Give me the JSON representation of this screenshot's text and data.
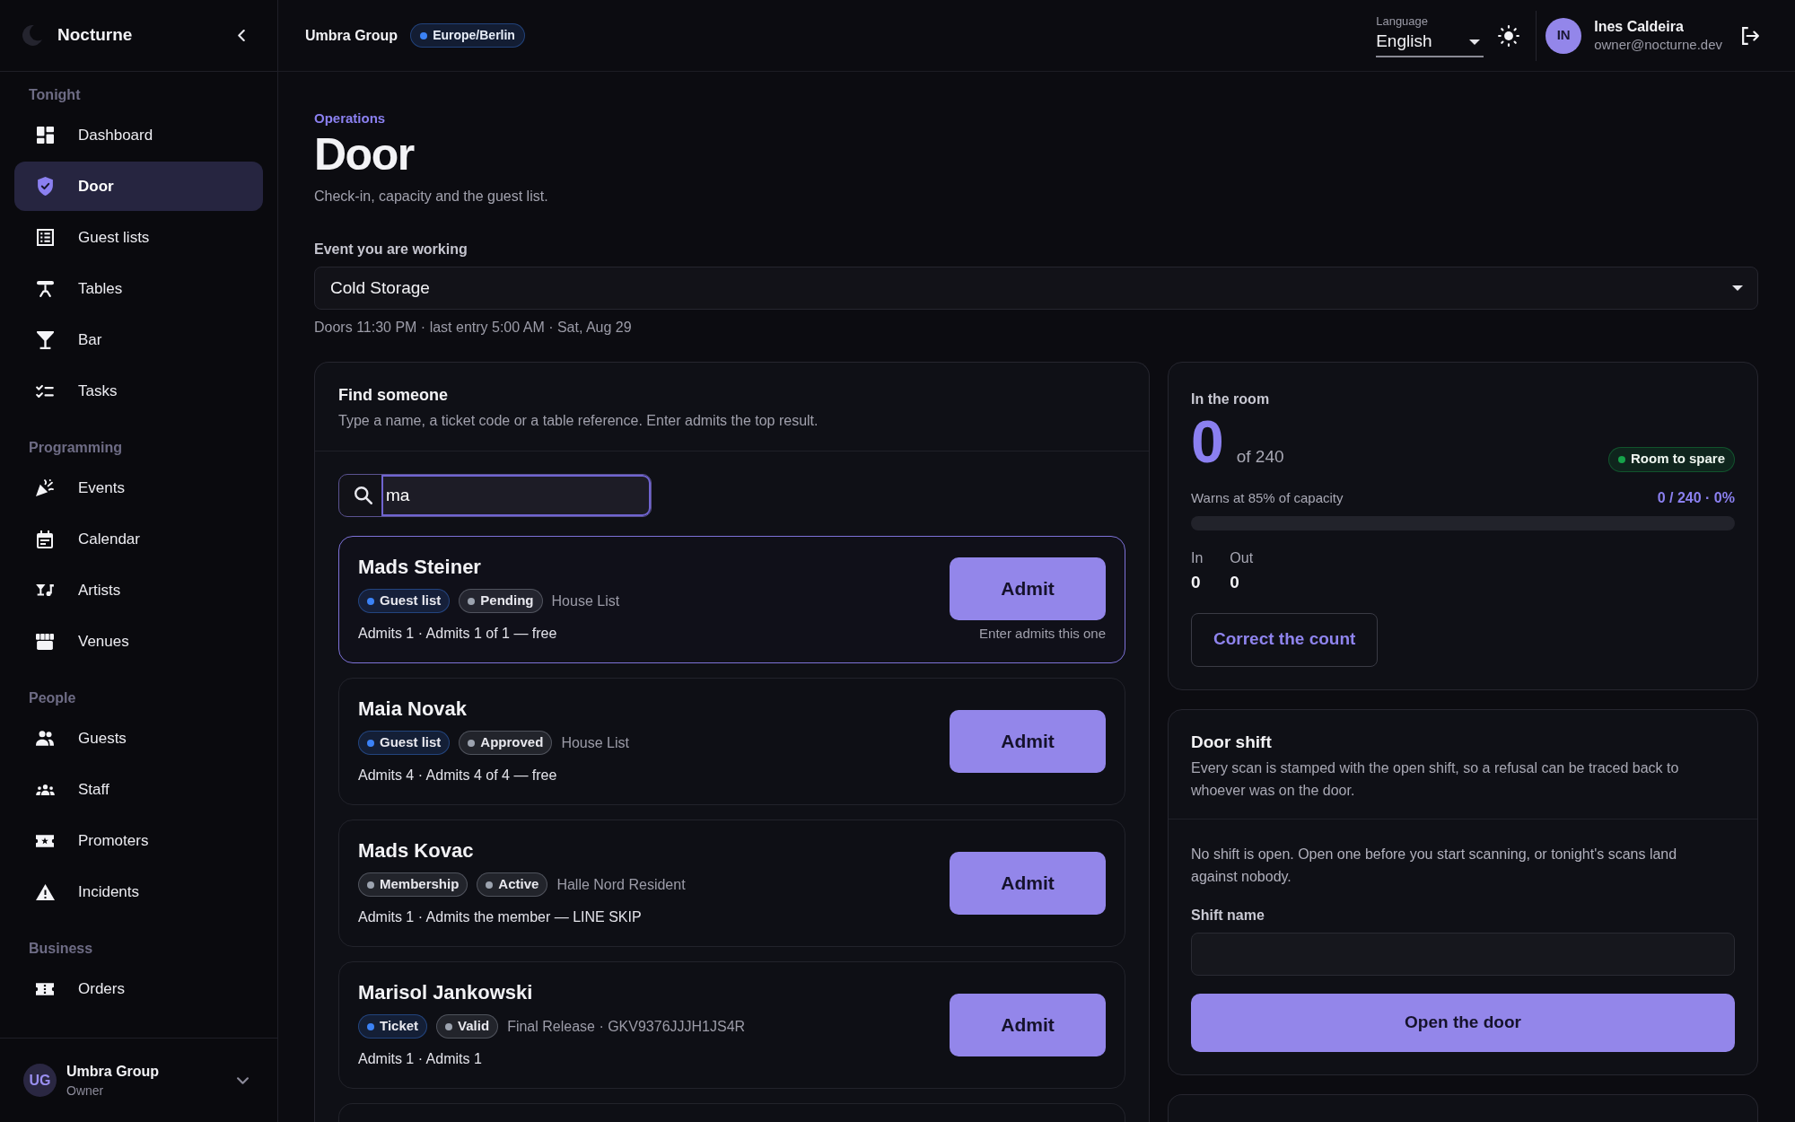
{
  "sidebar": {
    "brand": "Nocturne",
    "sections": [
      {
        "label": "Tonight",
        "items": [
          {
            "label": "Dashboard",
            "selected": false
          },
          {
            "label": "Door",
            "selected": true
          },
          {
            "label": "Guest lists",
            "selected": false
          },
          {
            "label": "Tables",
            "selected": false
          },
          {
            "label": "Bar",
            "selected": false
          },
          {
            "label": "Tasks",
            "selected": false
          }
        ]
      },
      {
        "label": "Programming",
        "items": [
          {
            "label": "Events",
            "selected": false
          },
          {
            "label": "Calendar",
            "selected": false
          },
          {
            "label": "Artists",
            "selected": false
          },
          {
            "label": "Venues",
            "selected": false
          }
        ]
      },
      {
        "label": "People",
        "items": [
          {
            "label": "Guests",
            "selected": false
          },
          {
            "label": "Staff",
            "selected": false
          },
          {
            "label": "Promoters",
            "selected": false
          },
          {
            "label": "Incidents",
            "selected": false
          }
        ]
      },
      {
        "label": "Business",
        "items": [
          {
            "label": "Orders",
            "selected": false
          }
        ]
      }
    ],
    "footer": {
      "initials": "UG",
      "name": "Umbra Group",
      "role": "Owner"
    }
  },
  "header": {
    "org": "Umbra Group",
    "timezone": {
      "label": "Europe/Berlin",
      "color": "#3b82f6"
    },
    "language": {
      "label": "Language",
      "value": "English"
    },
    "user": {
      "initials": "IN",
      "name": "Ines Caldeira",
      "email": "owner@nocturne.dev"
    }
  },
  "page": {
    "eyebrow": "Operations",
    "title": "Door",
    "subtitle": "Check-in, capacity and the guest list.",
    "event_select": {
      "label": "Event you are working",
      "value": "Cold Storage"
    },
    "event_details": "Doors 11:30 PM · last entry 5:00 AM · Sat, Aug 29"
  },
  "find": {
    "title": "Find someone",
    "description": "Type a name, a ticket code or a table reference. Enter admits the top result.",
    "search": {
      "value": "ma",
      "focused": true
    },
    "results": [
      {
        "name": "Mads Steiner",
        "tags": [
          {
            "label": "Guest list",
            "color": "#3b82f6"
          },
          {
            "label": "Pending",
            "color": "#9ca3af"
          }
        ],
        "list": "House List",
        "admits": "Admits 1 · Admits 1 of 1 — free",
        "action": "Admit",
        "hint": "Enter admits this one",
        "selected": true
      },
      {
        "name": "Maia Novak",
        "tags": [
          {
            "label": "Guest list",
            "color": "#3b82f6"
          },
          {
            "label": "Approved",
            "color": "#9ca3af"
          }
        ],
        "list": "House List",
        "admits": "Admits 4 · Admits 4 of 4 — free",
        "action": "Admit",
        "selected": false
      },
      {
        "name": "Mads Kovac",
        "tags": [
          {
            "label": "Membership",
            "color": "#9ca3af"
          },
          {
            "label": "Active",
            "color": "#9ca3af"
          }
        ],
        "list": "Halle Nord Resident",
        "admits": "Admits 1 · Admits the member — LINE SKIP",
        "action": "Admit",
        "selected": false
      },
      {
        "name": "Marisol Jankowski",
        "tags": [
          {
            "label": "Ticket",
            "color": "#3b82f6"
          },
          {
            "label": "Valid",
            "color": "#9ca3af"
          }
        ],
        "list": "Final Release · GKV9376JJJH1JS4R",
        "admits": "Admits 1 · Admits 1",
        "action": "Admit",
        "selected": false
      }
    ]
  },
  "room": {
    "title": "In the room",
    "count": "0",
    "capacity": "of 240",
    "status": {
      "label": "Room to spare",
      "color": "#16a34a"
    },
    "note": "Warns at 85% of capacity",
    "reading": "0 / 240 · 0%",
    "level": 0,
    "counters": [
      {
        "label": "In",
        "value": "0"
      },
      {
        "label": "Out",
        "value": "0"
      }
    ],
    "action": "Correct the count"
  },
  "shift": {
    "title": "Door shift",
    "description": "Every scan is stamped with the open shift, so a refusal can be traced back to whoever was on the door.",
    "notice": "No shift is open. Open one before you start scanning, or tonight's scans land against nobody.",
    "field": {
      "label": "Shift name"
    },
    "action": "Open the door"
  }
}
